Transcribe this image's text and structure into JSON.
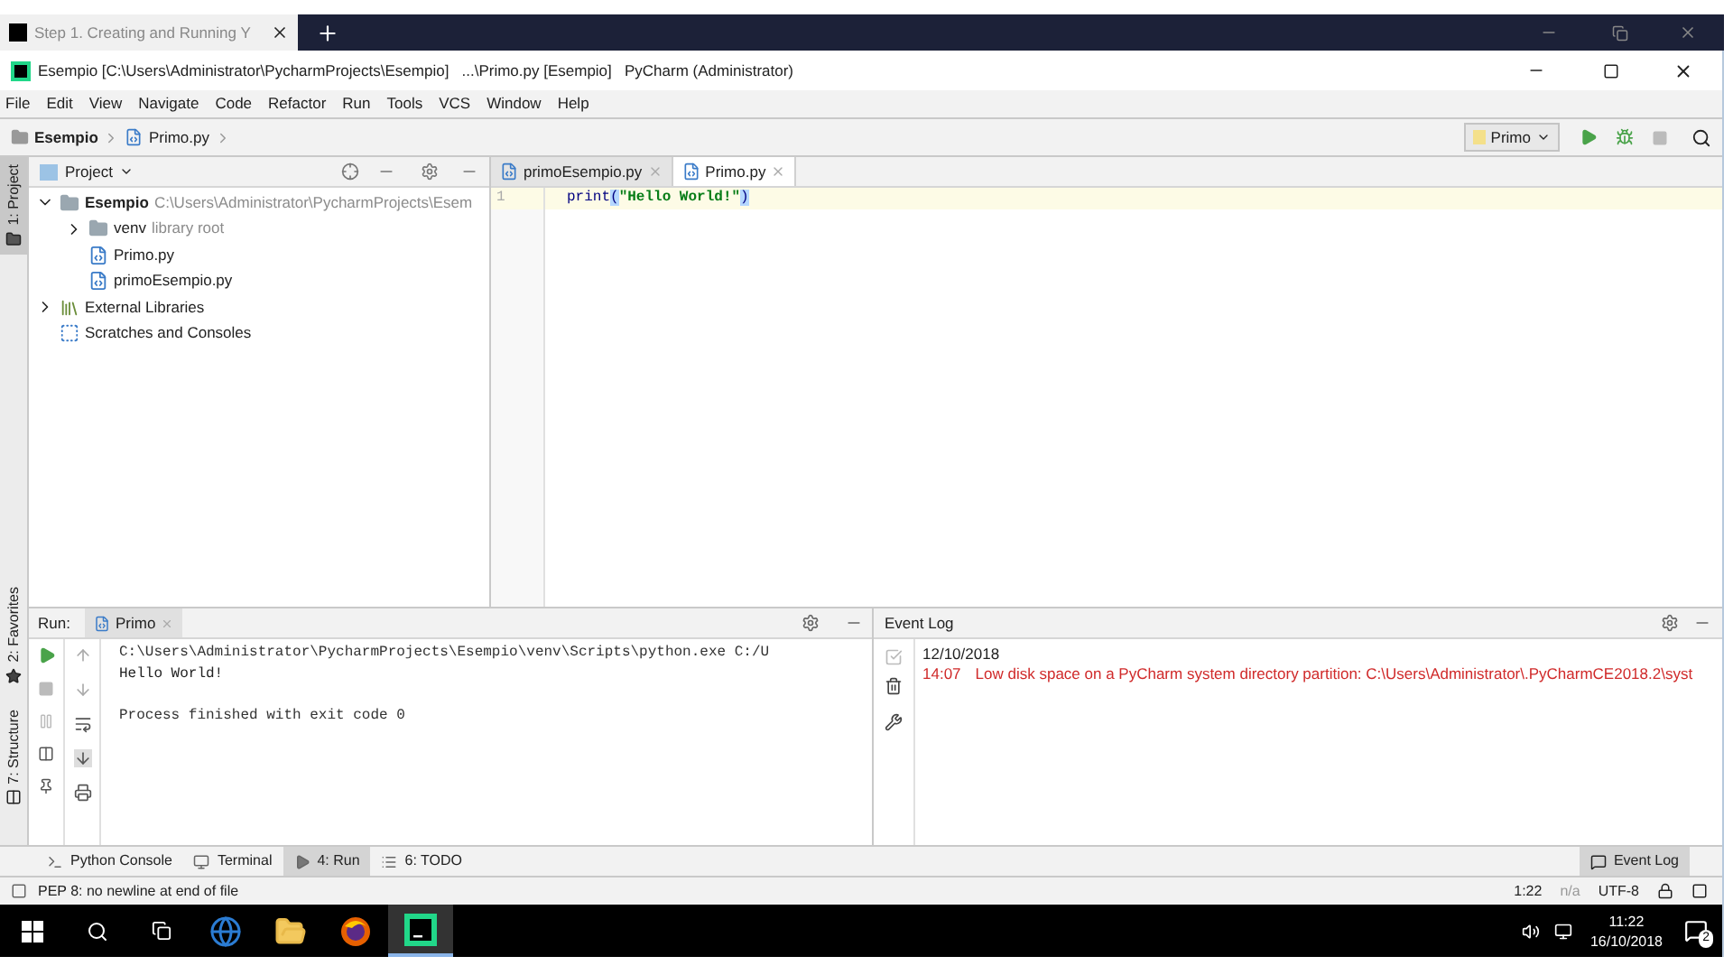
{
  "browser_tab": {
    "title": "Step 1. Creating and Running Y"
  },
  "window": {
    "title": "Esempio [C:\\Users\\Administrator\\PycharmProjects\\Esempio]   ...\\Primo.py [Esempio]   PyCharm (Administrator)"
  },
  "menu": [
    "File",
    "Edit",
    "View",
    "Navigate",
    "Code",
    "Refactor",
    "Run",
    "Tools",
    "VCS",
    "Window",
    "Help"
  ],
  "breadcrumb": [
    {
      "label": "Esempio",
      "kind": "folder"
    },
    {
      "label": "Primo.py",
      "kind": "file"
    }
  ],
  "run_config": "Primo",
  "side_tabs": [
    {
      "label": "1: Project",
      "selected": true,
      "kind": "project"
    },
    {
      "label": "2: Favorites",
      "selected": false,
      "kind": "favorites"
    },
    {
      "label": "7: Structure",
      "selected": false,
      "kind": "structure"
    }
  ],
  "project_panel": {
    "title": "Project",
    "tree": [
      {
        "label": "Esempio",
        "hint": "C:\\Users\\Administrator\\PycharmProjects\\Esem",
        "kind": "folder",
        "expanded": true,
        "children": [
          {
            "label": "venv",
            "hint": "library root",
            "kind": "folder",
            "expanded": false
          },
          {
            "label": "Primo.py",
            "kind": "file"
          },
          {
            "label": "primoEsempio.py",
            "kind": "file"
          }
        ]
      },
      {
        "label": "External Libraries",
        "kind": "library",
        "expanded": false
      },
      {
        "label": "Scratches and Consoles",
        "kind": "scratches"
      }
    ]
  },
  "editor": {
    "tabs": [
      {
        "label": "primoEsempio.py",
        "selected": false
      },
      {
        "label": "Primo.py",
        "selected": true
      }
    ],
    "lines": [
      {
        "number": "1",
        "tokens": [
          {
            "text": "print",
            "kind": "plain"
          },
          {
            "text": "(",
            "kind": "brace"
          },
          {
            "text": "\"Hello World!\"",
            "kind": "string"
          },
          {
            "text": ")",
            "kind": "brace"
          }
        ]
      }
    ]
  },
  "run_panel": {
    "label": "Run:",
    "tab": "Primo",
    "output": [
      {
        "text": "C:\\Users\\Administrator\\PycharmProjects\\Esempio\\venv\\Scripts\\python.exe C:/U",
        "kind": "command"
      },
      {
        "text": "Hello World!",
        "kind": "stdout"
      },
      {
        "text": "Process finished with exit code 0",
        "kind": "status"
      }
    ]
  },
  "event_log": {
    "title": "Event Log",
    "date": "12/10/2018",
    "entries": [
      {
        "time": "14:07",
        "message": "Low disk space on a PyCharm system directory partition: C:\\Users\\Administrator\\.PyCharmCE2018.2\\syst"
      }
    ]
  },
  "tool_tabs": [
    {
      "label": "Python Console",
      "selected": false,
      "kind": "console"
    },
    {
      "label": "Terminal",
      "selected": false,
      "kind": "terminal"
    },
    {
      "label": "4: Run",
      "selected": true,
      "kind": "run"
    },
    {
      "label": "6: TODO",
      "selected": false,
      "kind": "todo"
    }
  ],
  "event_log_button": "Event Log",
  "status_bar": {
    "message": "PEP 8: no newline at end of file",
    "position": "1:22",
    "line_separator": "n/a",
    "encoding": "UTF-8"
  },
  "taskbar": {
    "apps": [
      {
        "kind": "edge",
        "selected": false
      },
      {
        "kind": "explorer",
        "selected": false
      },
      {
        "kind": "firefox",
        "selected": false
      },
      {
        "kind": "pycharm",
        "selected": true
      }
    ],
    "time": "11:22",
    "date": "16/10/2018",
    "notifications": "2"
  }
}
